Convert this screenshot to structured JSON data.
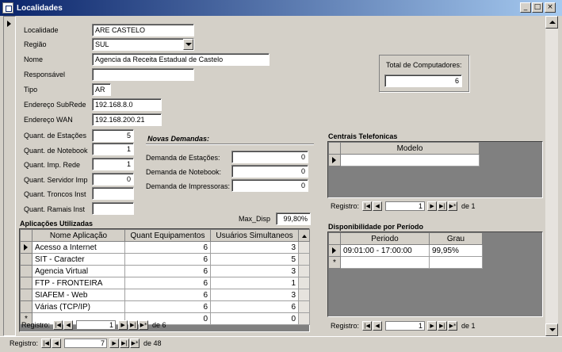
{
  "window": {
    "title": "Localidades"
  },
  "fields": [
    {
      "key": "localidade",
      "label": "Localidade",
      "value": "ARE CASTELO"
    },
    {
      "key": "regiao",
      "label": "Região",
      "value": "SUL"
    },
    {
      "key": "nome",
      "label": "Nome",
      "value": "Agencia da Receita Estadual de Castelo"
    },
    {
      "key": "responsavel",
      "label": "Responsável",
      "value": ""
    },
    {
      "key": "tipo",
      "label": "Tipo",
      "value": "AR"
    },
    {
      "key": "subrede",
      "label": "Endereço SubRede",
      "value": "192.168.8.0"
    },
    {
      "key": "wan",
      "label": "Endereço WAN",
      "value": "192.168.200.21"
    }
  ],
  "quant": [
    {
      "label": "Quant. de Estações",
      "value": "5"
    },
    {
      "label": "Quant. de Notebook",
      "value": "1"
    },
    {
      "label": "Quant. Imp. Rede",
      "value": "1"
    },
    {
      "label": "Quant. Servidor Imp",
      "value": "0"
    },
    {
      "label": "Quant. Troncos Inst",
      "value": ""
    },
    {
      "label": "Quant. Ramais Inst",
      "value": ""
    }
  ],
  "total_computadores": {
    "label": "Total de Computadores:",
    "value": "6"
  },
  "novas_demandas": {
    "title": "Novas Demandas:",
    "items": [
      {
        "label": "Demanda de Estações:",
        "value": "0"
      },
      {
        "label": "Demanda de Notebook:",
        "value": "0"
      },
      {
        "label": "Demanda de Impressoras:",
        "value": "0"
      }
    ]
  },
  "max_disp": {
    "label": "Max_Disp",
    "value": "99,80%"
  },
  "aplicacoes": {
    "title": "Aplicações Utilizadas",
    "columns": [
      "Nome Aplicação",
      "Quant Equipamentos",
      "Usuários Simultaneos"
    ],
    "rows": [
      [
        "Acesso a Internet",
        "6",
        "3"
      ],
      [
        "SIT - Caracter",
        "6",
        "5"
      ],
      [
        "Agencia Virtual",
        "6",
        "3"
      ],
      [
        "FTP - FRONTEIRA",
        "6",
        "1"
      ],
      [
        "SIAFEM - Web",
        "6",
        "3"
      ],
      [
        "Várias (TCP/IP)",
        "6",
        "6"
      ],
      [
        "",
        "0",
        "0"
      ]
    ],
    "nav": {
      "label": "Registro:",
      "current": "1",
      "of": "de 6"
    }
  },
  "centrais": {
    "title": "Centrais Telefonicas",
    "columns": [
      "Modelo"
    ],
    "nav": {
      "label": "Registro:",
      "current": "1",
      "of": "de 1"
    }
  },
  "disponibilidade": {
    "title": "Disponibilidade por Período",
    "columns": [
      "Periodo",
      "Grau"
    ],
    "rows": [
      [
        "09:01:00 - 17:00:00",
        "99,95%"
      ]
    ],
    "nav": {
      "label": "Registro:",
      "current": "1",
      "of": "de 1"
    }
  },
  "main_nav": {
    "label": "Registro:",
    "current": "7",
    "of": "de 48"
  },
  "nav_glyphs": {
    "first": "|◀",
    "prev": "◀",
    "next": "▶",
    "last": "▶|",
    "new": "▶*"
  },
  "new_row_marker": "*",
  "window_buttons": {
    "minimize": "_",
    "maximize": "□",
    "close": "×"
  }
}
